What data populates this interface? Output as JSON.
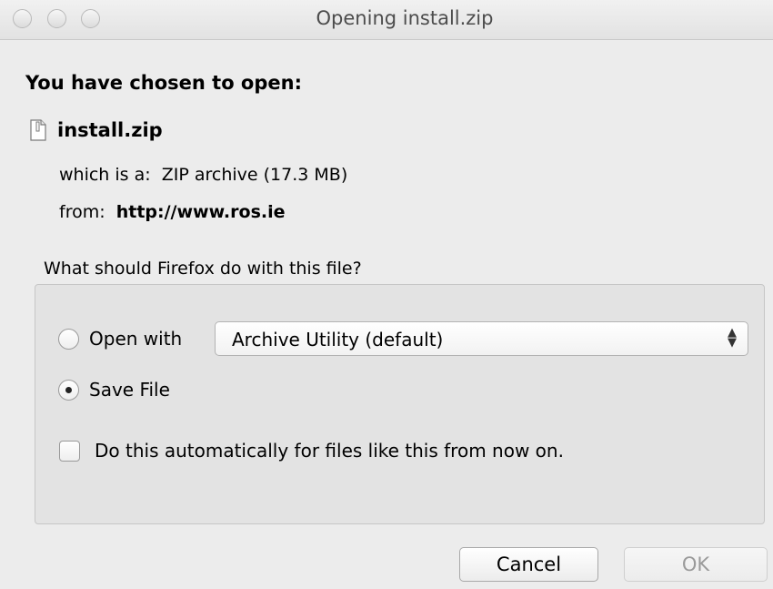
{
  "window": {
    "title": "Opening install.zip"
  },
  "dialog": {
    "heading": "You have chosen to open:",
    "file_name": "install.zip",
    "type_prefix": "which is a:",
    "type_value": "ZIP archive (17.3 MB)",
    "from_prefix": "from:",
    "from_value": "http://www.ros.ie",
    "question": "What should Firefox do with this file?"
  },
  "options": {
    "open_with_label": "Open with",
    "open_with_app": "Archive Utility (default)",
    "open_with_selected": false,
    "save_file_label": "Save File",
    "save_file_selected": true,
    "auto_label": "Do this automatically for files like this from now on.",
    "auto_checked": false
  },
  "buttons": {
    "cancel": "Cancel",
    "ok": "OK"
  },
  "icons": {
    "window_controls": [
      "close-icon",
      "minimize-icon",
      "zoom-icon"
    ],
    "file": "document-icon",
    "select_arrows": "updown-arrows-icon"
  }
}
